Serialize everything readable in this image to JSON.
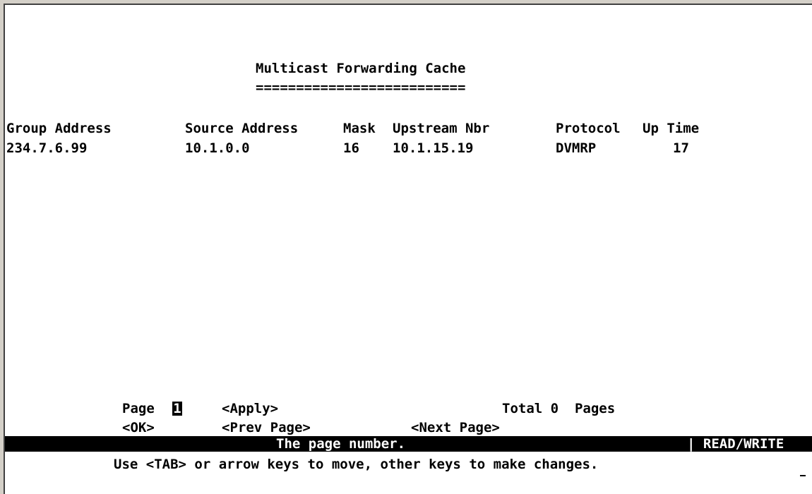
{
  "screen": {
    "title": "Multicast Forwarding Cache",
    "title_underline": "=========================="
  },
  "table": {
    "columns": [
      "Group Address",
      "Source Address",
      "Mask",
      "Upstream Nbr",
      "Protocol",
      "Up Time"
    ],
    "rows": [
      {
        "group_address": "234.7.6.99",
        "source_address": "10.1.0.0",
        "mask": "16",
        "upstream_nbr": "10.1.15.19",
        "protocol": "DVMRP",
        "up_time": "17"
      }
    ]
  },
  "pagination": {
    "page_label": "Page",
    "page_value": "1",
    "apply_label": "<Apply>",
    "total_label": "Total 0  Pages",
    "ok_label": "<OK>",
    "prev_label": "<Prev Page>",
    "next_label": "<Next Page>"
  },
  "status": {
    "message": "The page number.",
    "mode": "| READ/WRITE"
  },
  "help_text": "Use <TAB> or arrow keys to move, other keys to make changes."
}
